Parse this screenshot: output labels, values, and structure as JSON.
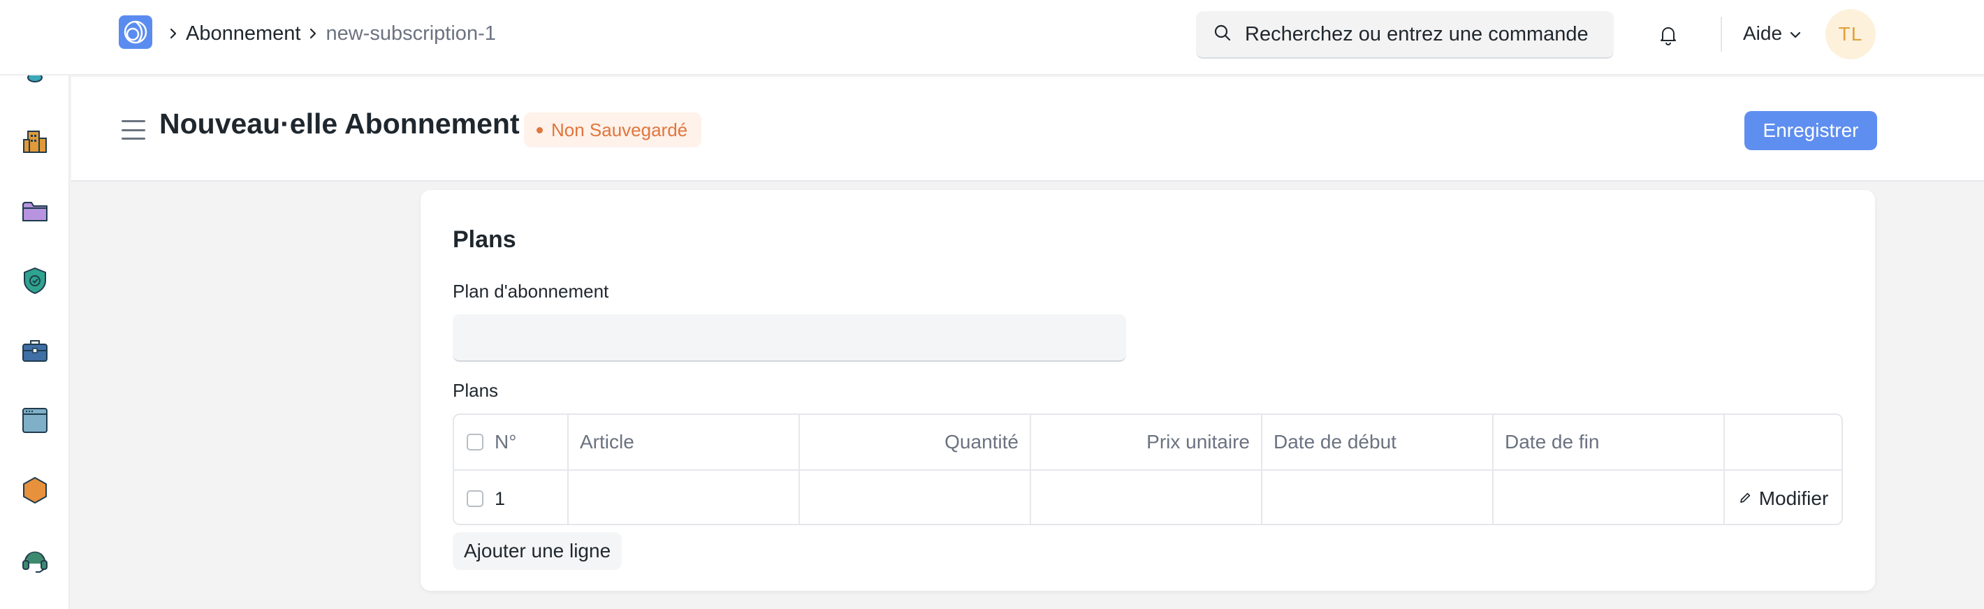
{
  "navbar": {
    "logo_icon": "app-logo-icon",
    "breadcrumbs": [
      {
        "label": "Abonnement"
      },
      {
        "label": "new-subscription-1"
      }
    ],
    "search": {
      "placeholder": "Recherchez ou entrez une commande",
      "value": ""
    },
    "help_label": "Aide",
    "avatar_initials": "TL"
  },
  "sidebar": {
    "items": [
      {
        "icon": "database-icon",
        "color": "#3aa8b8"
      },
      {
        "icon": "buildings-icon",
        "color": "#e09a3a"
      },
      {
        "icon": "folder-icon",
        "color": "#b793e0"
      },
      {
        "icon": "shield-check-icon",
        "color": "#2fa38d"
      },
      {
        "icon": "briefcase-icon",
        "color": "#3f6fa5"
      },
      {
        "icon": "window-icon",
        "color": "#7fb0c8"
      },
      {
        "icon": "hexagon-icon",
        "color": "#e8913c"
      },
      {
        "icon": "headset-icon",
        "color": "#3d8a6e"
      }
    ]
  },
  "header": {
    "title": "Nouveau·elle Abonnement",
    "status": "Non Sauvegardé",
    "save_label": "Enregistrer"
  },
  "form": {
    "section_title": "Plans",
    "plan_label": "Plan d'abonnement",
    "plan_value": "",
    "table_label": "Plans",
    "columns": [
      "N°",
      "Article",
      "Quantité",
      "Prix unitaire",
      "Date de début",
      "Date de fin"
    ],
    "rows": [
      {
        "num": "1",
        "article": "",
        "quantity": "",
        "price": "",
        "start": "",
        "end": "",
        "action": "Modifier"
      }
    ],
    "add_row_label": "Ajouter une ligne"
  },
  "colors": {
    "primary": "#5e8eef",
    "status_orange": "#e0763d",
    "avatar_bg": "#fdf1dc"
  }
}
